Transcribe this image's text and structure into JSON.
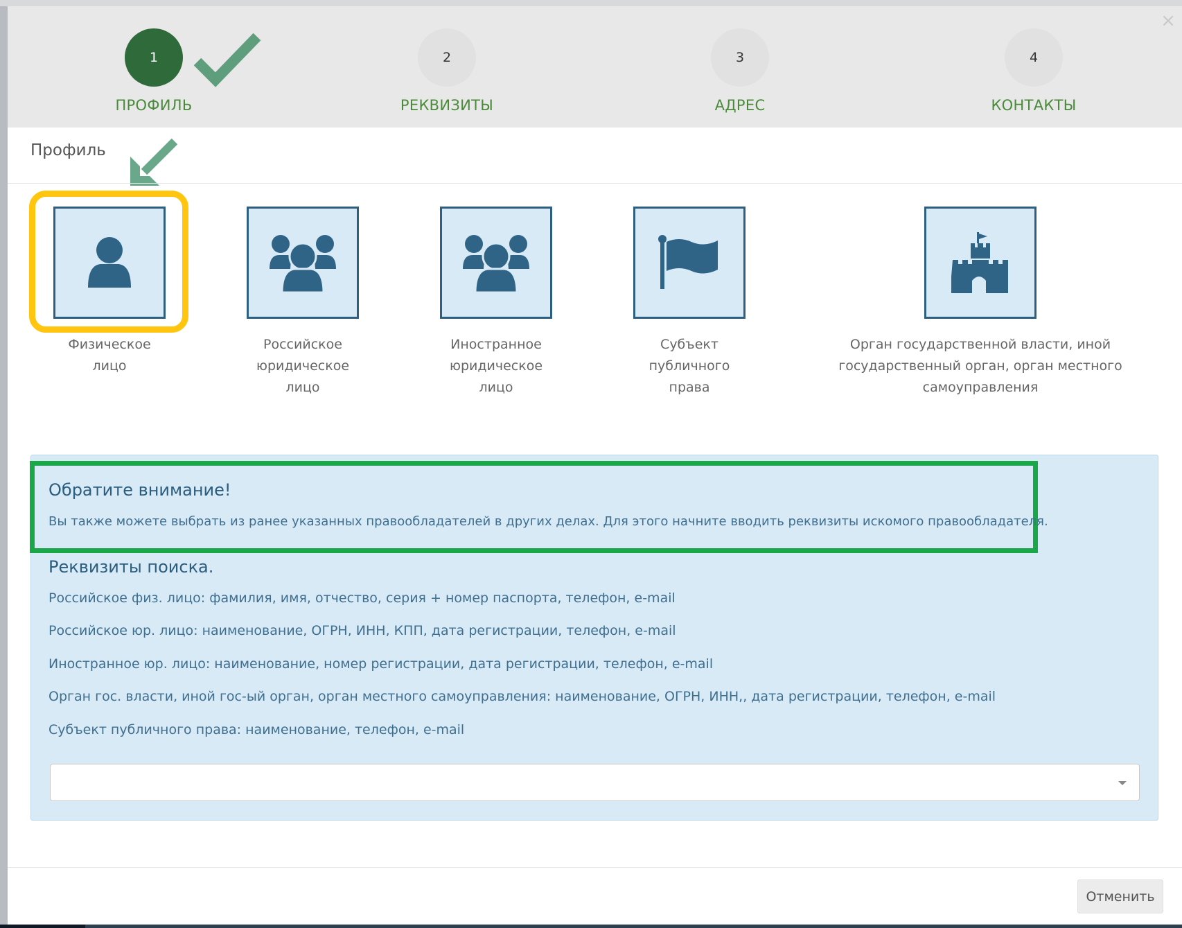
{
  "steps": [
    {
      "number": "1",
      "label": "ПРОФИЛЬ",
      "active": true
    },
    {
      "number": "2",
      "label": "РЕКВИЗИТЫ",
      "active": false
    },
    {
      "number": "3",
      "label": "АДРЕС",
      "active": false
    },
    {
      "number": "4",
      "label": "КОНТАКТЫ",
      "active": false
    }
  ],
  "close_symbol": "×",
  "section_title": "Профиль",
  "options": [
    {
      "label": "Физическое\nлицо",
      "icon": "user-icon",
      "selected": true
    },
    {
      "label": "Российское\nюридическое\nлицо",
      "icon": "users-icon"
    },
    {
      "label": "Иностранное\nюридическое\nлицо",
      "icon": "users-icon"
    },
    {
      "label": "Субъект\nпубличного\nправа",
      "icon": "flag-icon"
    },
    {
      "label": "Орган государственной власти, иной\nгосударственный орган, орган местного\nсамоуправления",
      "icon": "castle-icon"
    }
  ],
  "notice": {
    "title": "Обратите внимание!",
    "text": "Вы также можете выбрать из ранее указанных правообладателей в других делах. Для этого начните вводить реквизиты искомого правообладателя."
  },
  "requisites": {
    "title": "Реквизиты поиска.",
    "lines": [
      "Российское физ. лицо: фамилия, имя, отчество, серия + номер паспорта, телефон, e-mail",
      "Российское юр. лицо: наименование, ОГРН, ИНН, КПП, дата регистрации, телефон, e-mail",
      "Иностранное юр. лицо: наименование, номер регистрации, дата регистрации, телефон, e-mail",
      "Орган гос. власти, иной гос-ый орган, орган местного самоуправления: наименование, ОГРН, ИНН,, дата регистрации, телефон, e-mail",
      "Субъект публичного права: наименование, телефон, e-mail"
    ]
  },
  "search_select": {
    "value": ""
  },
  "footer": {
    "cancel_label": "Отменить"
  },
  "colors": {
    "step_active": "#2f6b3a",
    "step_label": "#4a8a3a",
    "option_border": "#2e5e80",
    "option_bg": "#d9eaf7",
    "highlight_yellow": "#ffc50f",
    "highlight_green": "#1aa74a"
  }
}
